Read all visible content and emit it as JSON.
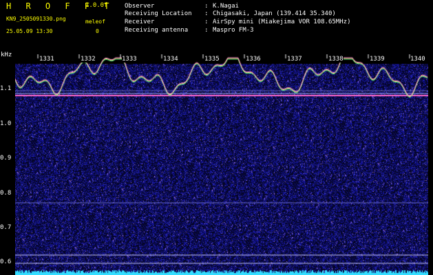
{
  "header": {
    "title": "H R O F F T",
    "version": "1.0.0f",
    "filename": "KN9_2505091330.png",
    "timestamp": "25.05.09 13:30",
    "meleo_label": "meleof",
    "meleo_value": "0"
  },
  "info": [
    {
      "label": "Observer",
      "value": "K.Nagai"
    },
    {
      "label": "Receiving Location",
      "value": "Chigasaki, Japan (139.414 35.340)"
    },
    {
      "label": "Receiver",
      "value": "AirSpy mini (Miakejima VOR 108.65MHz)"
    },
    {
      "label": "Receiving antenna",
      "value": "Maspro FM-3"
    }
  ],
  "separator": ":",
  "plot": {
    "y_unit": "kHz",
    "y_ticks": [
      "1.1",
      "1.0",
      "0.9",
      "0.8",
      "0.7",
      "0.6"
    ],
    "time_labels": [
      "1331",
      "1332",
      "1333",
      "1334",
      "1335",
      "1336",
      "1337",
      "1338",
      "1339",
      "1340"
    ],
    "colors": {
      "background": "#000000",
      "noise": "#1a1a8c",
      "carrier": "#ff66cc",
      "trace": "#ffe97a",
      "baseline": "#33ddff",
      "axis_text": "#ffffff",
      "header_yellow": "#ffff00"
    }
  }
}
